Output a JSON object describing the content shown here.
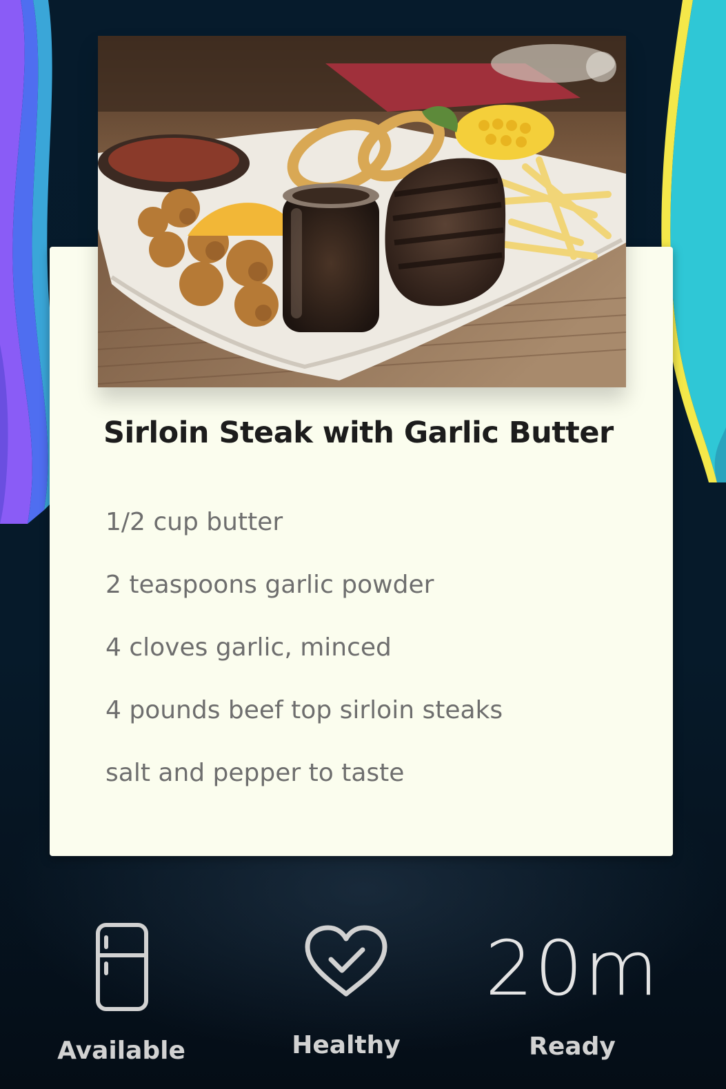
{
  "recipe": {
    "title": "Sirloin Steak with Garlic Butter",
    "ingredients": [
      "1/2 cup butter",
      "2 teaspoons garlic powder",
      "4 cloves garlic, minced",
      "4 pounds beef top sirloin steaks",
      "salt and pepper to taste"
    ]
  },
  "stats": {
    "available": {
      "label": "Available",
      "icon": "fridge-icon"
    },
    "healthy": {
      "label": "Healthy",
      "icon": "heart-check-icon"
    },
    "time": {
      "value": "20m",
      "label": "Ready"
    }
  },
  "colors": {
    "background": "#061a2a",
    "card": "#fbfdee",
    "title": "#1c1c1c",
    "ingredient_text": "#6e6e6e",
    "stat_text": "#d2d2d2",
    "stripe_left": [
      "#8a5cf6",
      "#4f6ef0",
      "#3aa6d8"
    ],
    "stripe_right": [
      "#f4e84a",
      "#2fc7d6"
    ]
  }
}
